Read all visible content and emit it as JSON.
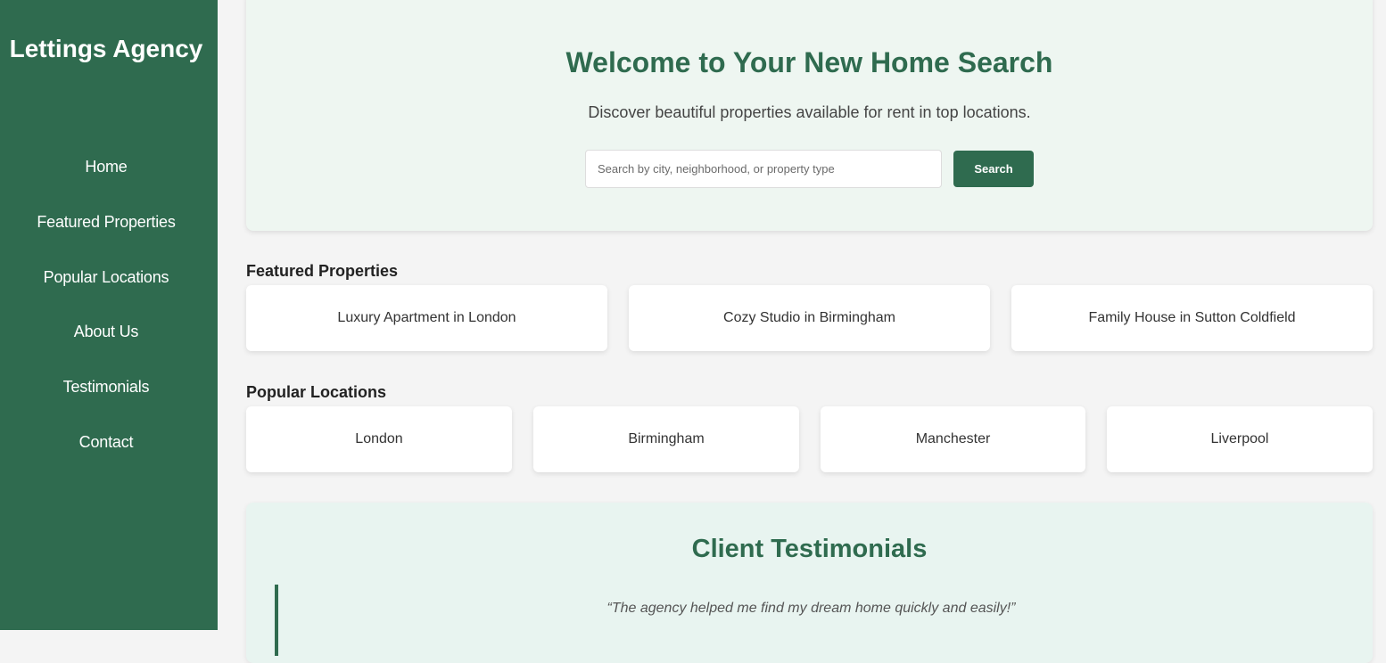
{
  "sidebar": {
    "brand": "Lettings Agency",
    "nav": [
      "Home",
      "Featured Properties",
      "Popular Locations",
      "About Us",
      "Testimonials",
      "Contact"
    ]
  },
  "hero": {
    "title": "Welcome to Your New Home Search",
    "subtitle": "Discover beautiful properties available for rent in top locations.",
    "search_placeholder": "Search by city, neighborhood, or property type",
    "search_value": "",
    "search_button": "Search"
  },
  "featured": {
    "title": "Featured Properties",
    "items": [
      "Luxury Apartment in London",
      "Cozy Studio in Birmingham",
      "Family House in Sutton Coldfield"
    ]
  },
  "locations": {
    "title": "Popular Locations",
    "items": [
      "London",
      "Birmingham",
      "Manchester",
      "Liverpool"
    ]
  },
  "testimonials": {
    "title": "Client Testimonials",
    "quotes": [
      "“The agency helped me find my dream home quickly and easily!”"
    ]
  },
  "colors": {
    "primary": "#2f6b4f",
    "hero_bg": "#eef6f1",
    "testimonials_bg": "#e8f4f0",
    "page_bg": "#f4f4f4"
  }
}
